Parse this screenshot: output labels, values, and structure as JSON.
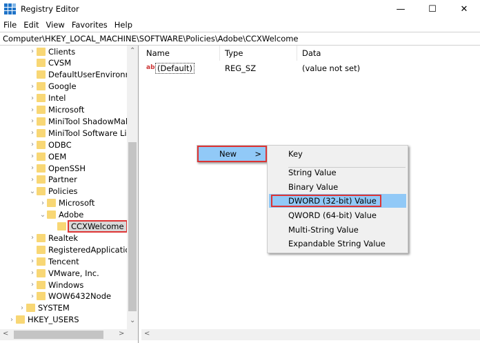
{
  "window": {
    "title": "Registry Editor",
    "min": "—",
    "max": "☐",
    "close": "✕"
  },
  "menu": [
    "File",
    "Edit",
    "View",
    "Favorites",
    "Help"
  ],
  "address": "Computer\\HKEY_LOCAL_MACHINE\\SOFTWARE\\Policies\\Adobe\\CCXWelcome",
  "tree": [
    {
      "label": "Clients",
      "level": 2,
      "chev": ">"
    },
    {
      "label": "CVSM",
      "level": 2,
      "chev": ""
    },
    {
      "label": "DefaultUserEnvironme",
      "level": 2,
      "chev": ""
    },
    {
      "label": "Google",
      "level": 2,
      "chev": ">"
    },
    {
      "label": "Intel",
      "level": 2,
      "chev": ">"
    },
    {
      "label": "Microsoft",
      "level": 2,
      "chev": ">"
    },
    {
      "label": "MiniTool ShadowMak",
      "level": 2,
      "chev": ">"
    },
    {
      "label": "MiniTool Software Lim",
      "level": 2,
      "chev": ">"
    },
    {
      "label": "ODBC",
      "level": 2,
      "chev": ">"
    },
    {
      "label": "OEM",
      "level": 2,
      "chev": ">"
    },
    {
      "label": "OpenSSH",
      "level": 2,
      "chev": ">"
    },
    {
      "label": "Partner",
      "level": 2,
      "chev": ">"
    },
    {
      "label": "Policies",
      "level": 2,
      "chev": "v"
    },
    {
      "label": "Microsoft",
      "level": 3,
      "chev": ">"
    },
    {
      "label": "Adobe",
      "level": 3,
      "chev": "v"
    },
    {
      "label": "CCXWelcome",
      "level": 4,
      "chev": "",
      "selected": true
    },
    {
      "label": "Realtek",
      "level": 2,
      "chev": ">"
    },
    {
      "label": "RegisteredApplication",
      "level": 2,
      "chev": ""
    },
    {
      "label": "Tencent",
      "level": 2,
      "chev": ">"
    },
    {
      "label": "VMware, Inc.",
      "level": 2,
      "chev": ">"
    },
    {
      "label": "Windows",
      "level": 2,
      "chev": ">"
    },
    {
      "label": "WOW6432Node",
      "level": 2,
      "chev": ">"
    },
    {
      "label": "SYSTEM",
      "level": 1,
      "chev": ">"
    },
    {
      "label": "HKEY_USERS",
      "level": 0,
      "chev": ">"
    }
  ],
  "columns": {
    "name": "Name",
    "type": "Type",
    "data": "Data"
  },
  "values": [
    {
      "icon": "ab",
      "name": "(Default)",
      "type": "REG_SZ",
      "data": "(value not set)"
    }
  ],
  "context_menu": {
    "new": "New",
    "arrow": ">"
  },
  "submenu": [
    "Key",
    "String Value",
    "Binary Value",
    "DWORD (32-bit) Value",
    "QWORD (64-bit) Value",
    "Multi-String Value",
    "Expandable String Value"
  ],
  "submenu_highlighted": "DWORD (32-bit) Value"
}
